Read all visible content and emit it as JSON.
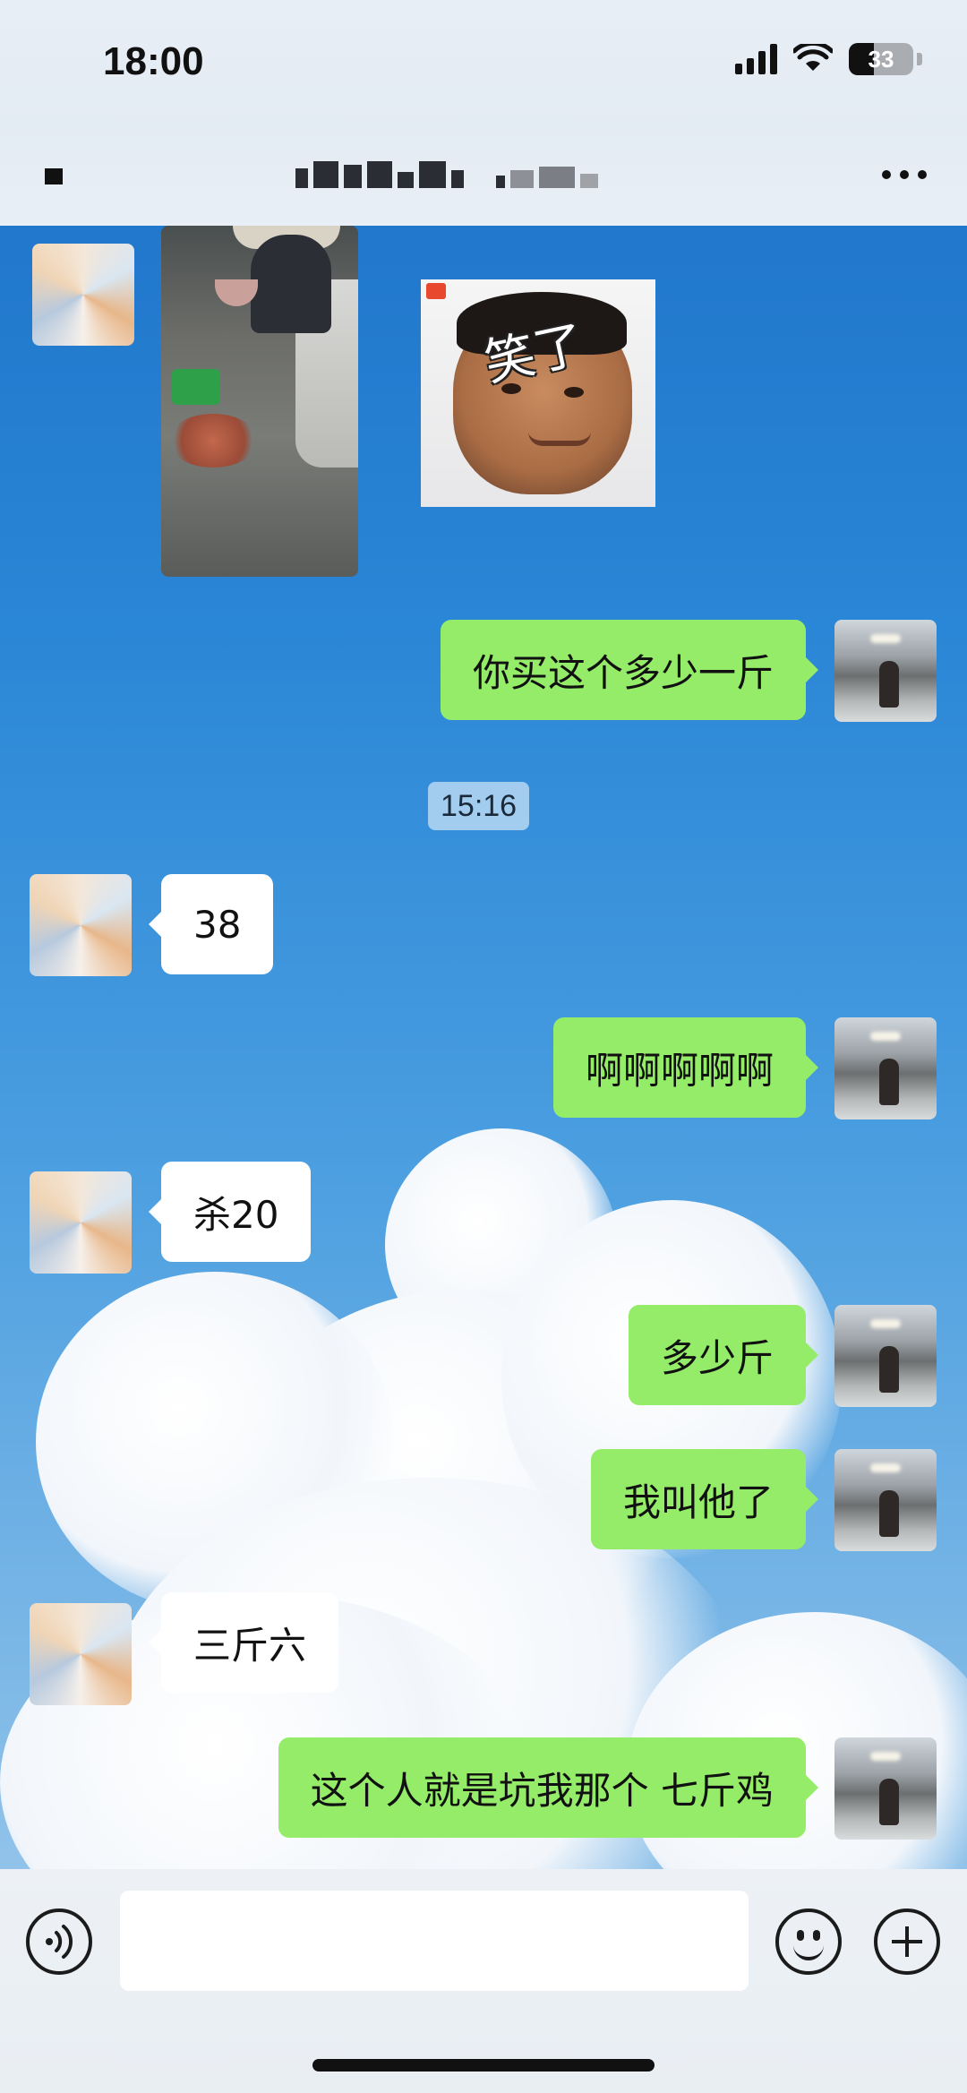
{
  "status_bar": {
    "time": "18:00",
    "battery_level": "33",
    "signal_icon": "cellular-signal-icon",
    "wifi_icon": "wifi-icon",
    "battery_icon": "battery-icon"
  },
  "header": {
    "contact_name_obscured": true,
    "more_icon": "more-horizontal-icon"
  },
  "messages": [
    {
      "side": "left",
      "type": "image",
      "content": "market-photo"
    },
    {
      "side": "right",
      "type": "sticker",
      "text": "笑了"
    },
    {
      "side": "right",
      "type": "text",
      "text": "你买这个多少一斤"
    },
    {
      "type": "timestamp",
      "text": "15:16"
    },
    {
      "side": "left",
      "type": "text",
      "text": "38"
    },
    {
      "side": "right",
      "type": "text",
      "text": "啊啊啊啊啊"
    },
    {
      "side": "left",
      "type": "text",
      "text": "杀20"
    },
    {
      "side": "right",
      "type": "text",
      "text": "多少斤"
    },
    {
      "side": "right",
      "type": "text",
      "text": "我叫他了"
    },
    {
      "side": "left",
      "type": "text",
      "text": "三斤六"
    },
    {
      "side": "right",
      "type": "text",
      "text": "这个人就是坑我那个 七斤鸡"
    }
  ],
  "input_bar": {
    "voice_icon": "voice-icon",
    "input_value": "",
    "emoji_icon": "emoji-icon",
    "plus_icon": "plus-icon"
  },
  "colors": {
    "sent_bubble": "#95ec69",
    "received_bubble": "#ffffff",
    "wallpaper_sky": "#2a84d4"
  }
}
